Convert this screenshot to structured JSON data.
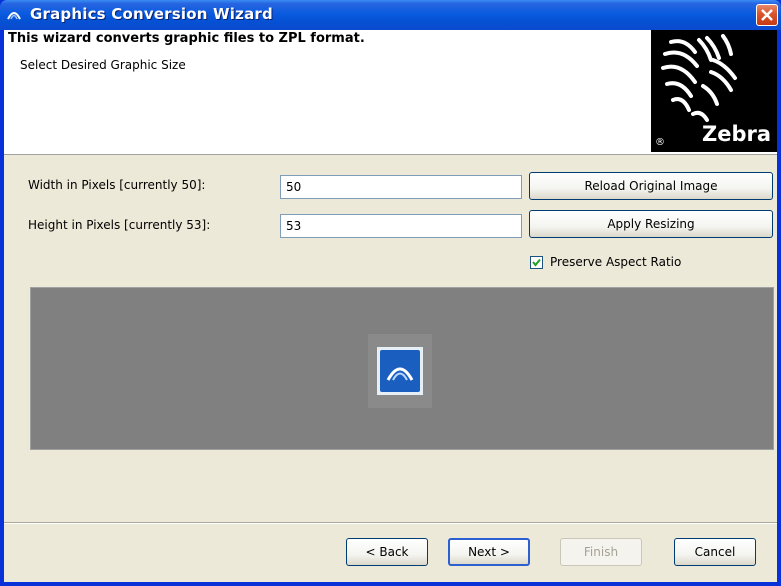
{
  "window": {
    "title": "Graphics Conversion Wizard"
  },
  "header": {
    "title": "This wizard converts graphic files to ZPL format.",
    "subtitle": "Select Desired Graphic Size",
    "logo_text": "Zebra",
    "logo_reg": "®"
  },
  "form": {
    "width_label": "Width in Pixels  [currently 50]:",
    "width_value": "50",
    "height_label": "Height in Pixels [currently 53]:",
    "height_value": "53",
    "reload_label": "Reload Original Image",
    "apply_label": "Apply Resizing",
    "preserve_label": "Preserve Aspect Ratio",
    "preserve_checked": true
  },
  "footer": {
    "back_label": "< Back",
    "next_label": "Next >",
    "finish_label": "Finish",
    "cancel_label": "Cancel"
  },
  "colors": {
    "titlebar": "#0551d3",
    "preview_bg": "#808080",
    "close": "#d9532b"
  },
  "icons": [
    "app-icon",
    "close-icon",
    "check-icon",
    "image-thumbnail"
  ]
}
